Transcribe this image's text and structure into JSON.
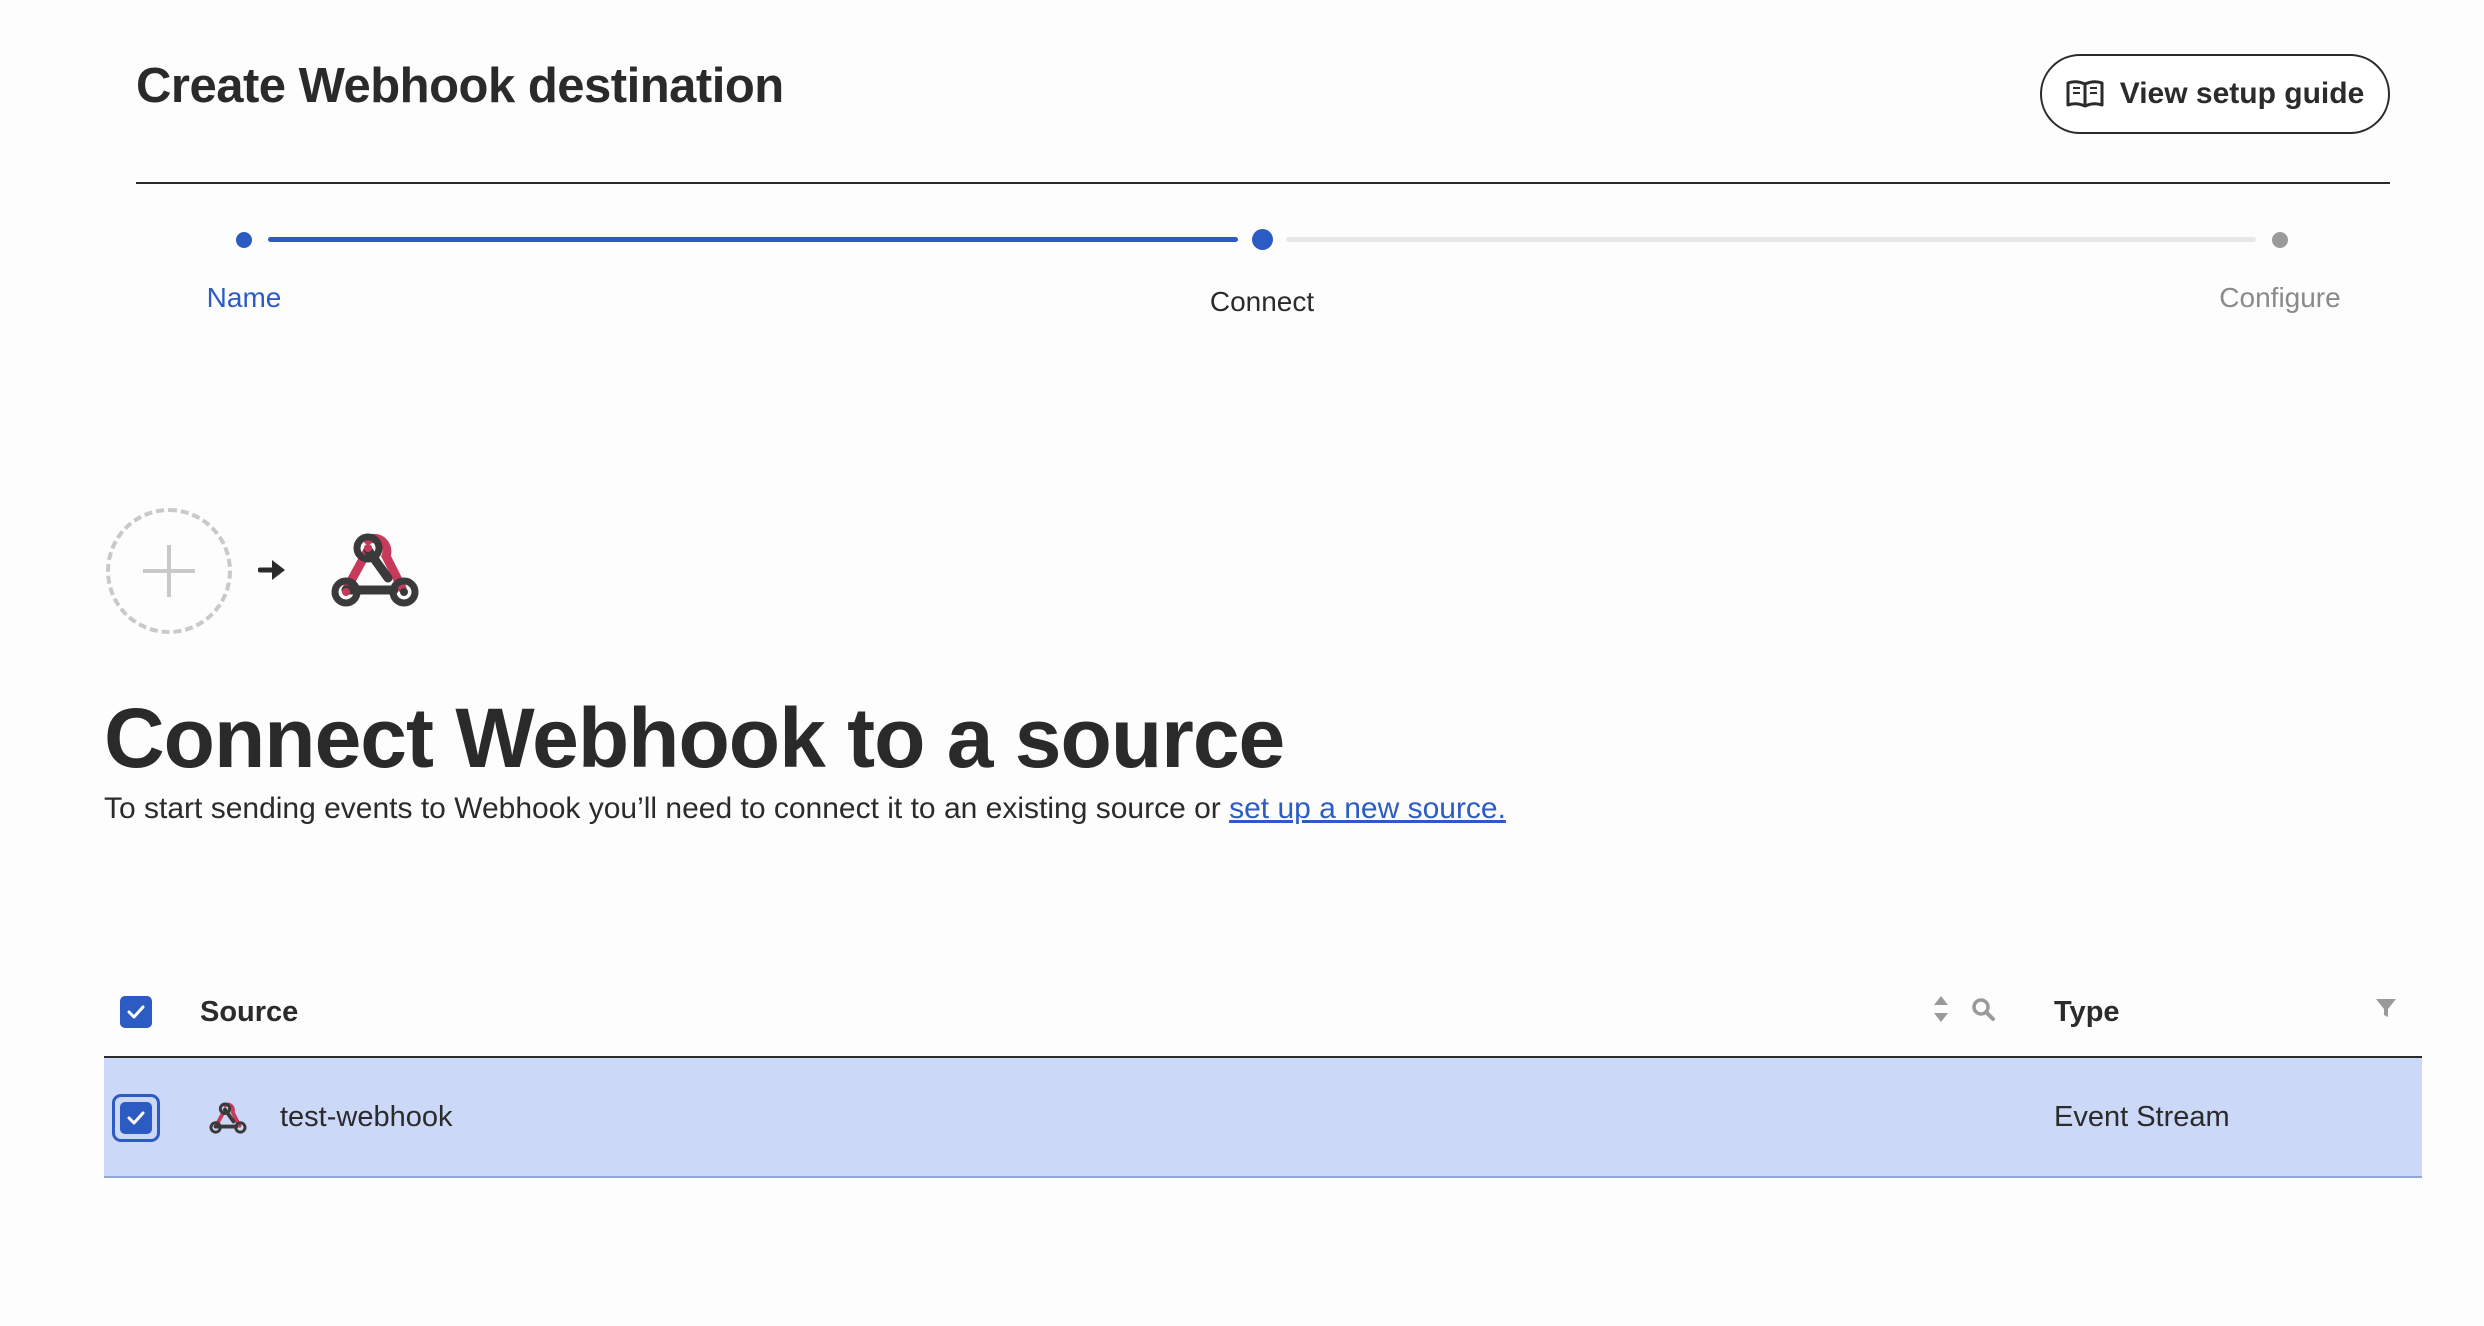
{
  "header": {
    "title": "Create Webhook destination",
    "guide_button_label": "View setup guide"
  },
  "stepper": {
    "steps": [
      {
        "label": "Name",
        "state": "completed"
      },
      {
        "label": "Connect",
        "state": "current"
      },
      {
        "label": "Configure",
        "state": "upcoming"
      }
    ],
    "progress": 0.5
  },
  "hero": {
    "heading": "Connect Webhook to a source",
    "description": "To start sending events to Webhook you’ll need to connect it to an existing source or",
    "link_text": "set up a new source."
  },
  "table": {
    "columns": [
      "Source",
      "Type"
    ],
    "header_checkbox_checked": true,
    "rows": [
      {
        "checked": true,
        "icon": "webhook-icon",
        "source": "test-webhook",
        "type": "Event Stream"
      }
    ]
  },
  "colors": {
    "accent": "#2d5bc4",
    "row_selected": "#cbd8f7",
    "webhook_red": "#c73a5a",
    "webhook_dark": "#3a3a3a"
  }
}
